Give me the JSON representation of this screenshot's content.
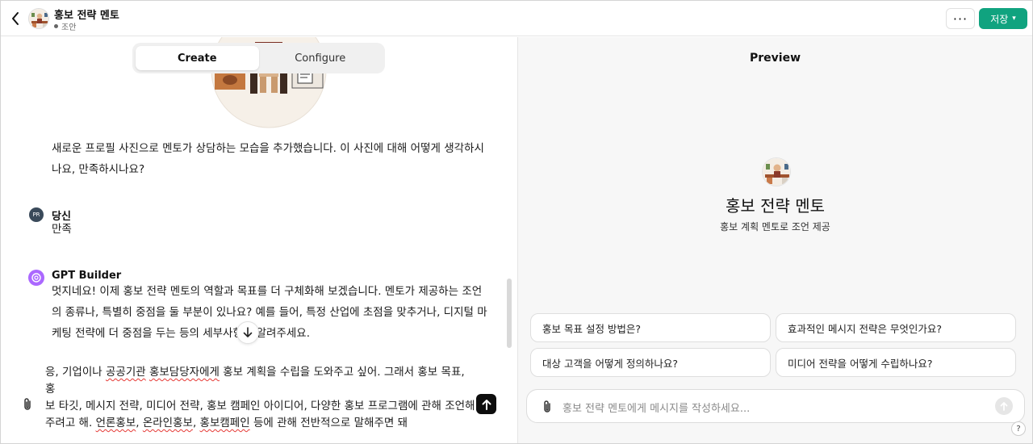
{
  "header": {
    "title": "홍보 전략 멘토",
    "status": "조안",
    "more_label": "···",
    "save_label": "저장"
  },
  "tabs": [
    {
      "label": "Create",
      "active": true
    },
    {
      "label": "Configure",
      "active": false
    }
  ],
  "conversation": {
    "builder_message_1": [
      "새로운 프로필 사진으로 멘토가 상담하는 모습을 추가했습니다. 이 사진에 대해 어떻게 생각하시",
      "나요, 만족하시나요?"
    ],
    "user": {
      "name": "당신",
      "initials": "PR",
      "message": "만족"
    },
    "builder": {
      "name": "GPT Builder",
      "message": [
        "멋지네요! 이제 홍보 전략 멘토의 역할과 목표를 더 구체화해 보겠습니다. 멘토가 제공하는 조언",
        "의 종류나, 특별히 중점을 둘 부분이 있나요? 예를 들어, 특정 산업에 초점을 맞추거나, 디지털 마",
        "케팅 전략에 더 중점을 두는 등의 세부사항을 알려주세요."
      ]
    }
  },
  "composer": {
    "line1_a": "응, 기업이나 ",
    "line1_spell1": "공공기관",
    "line1_b": " ",
    "line1_spell2": "홍보담당자에게",
    "line1_c": " 홍보 계획을 수립을 도와주고 싶어. 그래서 홍보 목표, 홍",
    "line2": "보 타깃, 메시지 전략, 미디어 전략, 홍보 캠페인 아이디어, 다양한 홍보 프로그램에 관해 조언해",
    "line3_a": "주려고 해. ",
    "line3_spell1": "언론홍보",
    "line3_b": ", ",
    "line3_spell2": "온라인홍보",
    "line3_c": ", ",
    "line3_spell3": "홍보캠페인",
    "line3_d": " 등에 관해 전반적으로 말해주면 돼"
  },
  "preview": {
    "title": "Preview",
    "name": "홍보 전략 멘토",
    "description": "홍보 계획 멘토로 조언 제공",
    "starters": [
      "홍보 목표 설정 방법은?",
      "효과적인 메시지 전략은 무엇인가요?",
      "대상 고객을 어떻게 정의하나요?",
      "미디어 전략을 어떻게 수립하나요?"
    ],
    "input_placeholder": "홍보 전략 멘토에게 메시지를 작성하세요...",
    "help_label": "?"
  },
  "colors": {
    "save_button": "#10a37f",
    "gpt_builder_avatar": "#ab68ff",
    "user_avatar": "#3a4a5a",
    "spellcheck": "#e53935"
  },
  "icons": {
    "back": "chevron-left-icon",
    "attach": "paperclip-icon",
    "send": "arrow-up-icon",
    "scroll_down": "arrow-down-icon"
  }
}
